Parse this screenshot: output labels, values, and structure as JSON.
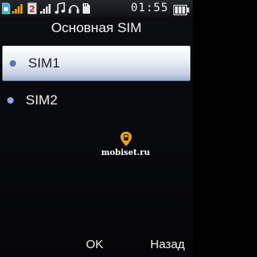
{
  "status_bar": {
    "time": "01:55",
    "icons": [
      "sim-card-icon",
      "signal-bars-icon",
      "roaming-icon",
      "signal-bars-2-icon",
      "music-note-icon",
      "headset-icon",
      "memory-card-icon",
      "battery-icon"
    ]
  },
  "title": "Основная SIM",
  "list": {
    "items": [
      {
        "label": "SIM1",
        "selected": true
      },
      {
        "label": "SIM2",
        "selected": false
      }
    ]
  },
  "softkeys": {
    "ok": "OK",
    "back": "Назад"
  },
  "watermark": "mobiset.ru",
  "colors": {
    "selection_top": "#ffffff",
    "selection_bottom": "#9fb0cf",
    "accent_dot": "#8ea6e6",
    "background": "#08090c",
    "text": "#f2f2f2"
  }
}
